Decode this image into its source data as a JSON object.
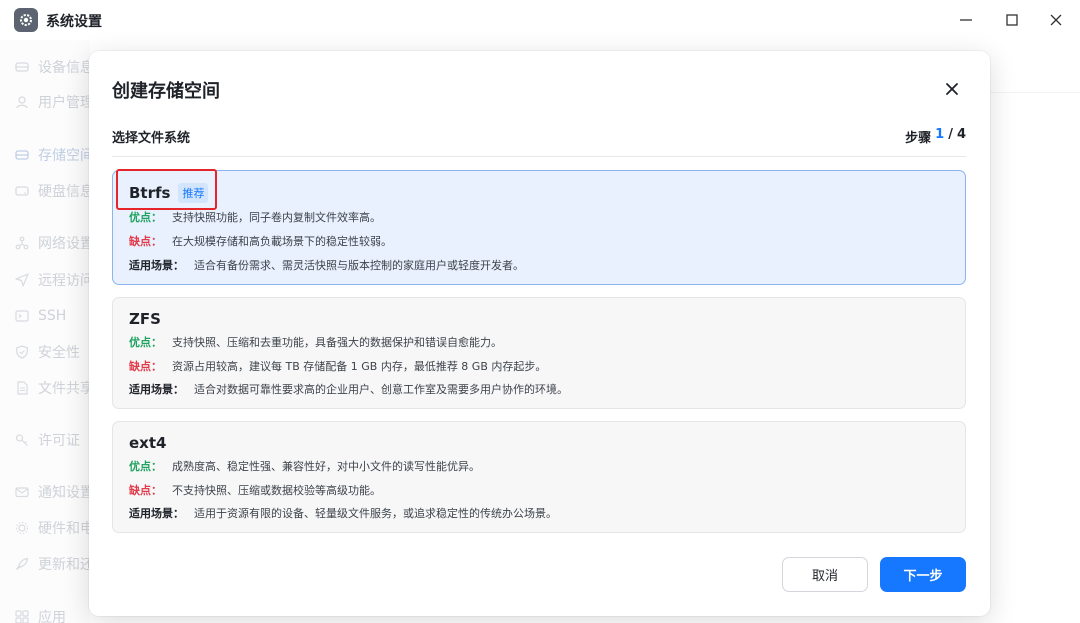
{
  "window": {
    "title": "系统设置"
  },
  "sidebar": {
    "items": [
      {
        "label": "设备信息",
        "icon": "drive-icon",
        "active": false
      },
      {
        "label": "用户管理",
        "icon": "user-icon",
        "active": false
      },
      {
        "label": "存储空间",
        "icon": "storage-icon",
        "active": true
      },
      {
        "label": "硬盘信息",
        "icon": "disk-icon",
        "active": false
      },
      {
        "label": "网络设置",
        "icon": "network-icon",
        "active": false
      },
      {
        "label": "远程访问",
        "icon": "send-icon",
        "active": false
      },
      {
        "label": "SSH",
        "icon": "terminal-icon",
        "active": false
      },
      {
        "label": "安全性",
        "icon": "shield-icon",
        "active": false
      },
      {
        "label": "文件共享",
        "icon": "file-icon",
        "active": false
      },
      {
        "label": "许可证",
        "icon": "key-icon",
        "active": false
      },
      {
        "label": "通知设置",
        "icon": "mail-icon",
        "active": false
      },
      {
        "label": "硬件和电源",
        "icon": "hardware-icon",
        "active": false
      },
      {
        "label": "更新和还原",
        "icon": "rocket-icon",
        "active": false
      },
      {
        "label": "应用",
        "icon": "apps-icon",
        "active": false
      }
    ]
  },
  "modal": {
    "title": "创建存储空间",
    "section_label": "选择文件系统",
    "step_prefix": "步骤",
    "step_current": "1",
    "step_sep": "/",
    "step_total": "4",
    "options": [
      {
        "name": "Btrfs",
        "badge": "推荐",
        "selected": true,
        "pro_label": "优点：",
        "pro": "支持快照功能，同子卷内复制文件效率高。",
        "con_label": "缺点：",
        "con": "在大规模存储和高负載场景下的稳定性较弱。",
        "use_label": "适用场景：",
        "use": "适合有备份需求、需灵活快照与版本控制的家庭用户或轻度开发者。"
      },
      {
        "name": "ZFS",
        "badge": "",
        "selected": false,
        "pro_label": "优点：",
        "pro": "支持快照、压缩和去重功能，具备强大的数据保护和错误自愈能力。",
        "con_label": "缺点：",
        "con": "资源占用较高，建议每 TB 存储配备 1 GB 内存，最低推荐 8 GB 内存起步。",
        "use_label": "适用场景：",
        "use": "适合对数据可靠性要求高的企业用户、创意工作室及需要多用户协作的环境。"
      },
      {
        "name": "ext4",
        "badge": "",
        "selected": false,
        "pro_label": "优点：",
        "pro": "成熟度高、稳定性强、兼容性好，对中小文件的读写性能优异。",
        "con_label": "缺点：",
        "con": "不支持快照、压缩或数据校验等高级功能。",
        "use_label": "适用场景：",
        "use": "适用于资源有限的设备、轻量级文件服务，或追求稳定性的传统办公场景。"
      }
    ],
    "cancel_label": "取消",
    "next_label": "下一步"
  },
  "colors": {
    "accent": "#1677ff",
    "pro": "#1ea35e",
    "con": "#e23a4a",
    "highlight": "#e5252a"
  }
}
